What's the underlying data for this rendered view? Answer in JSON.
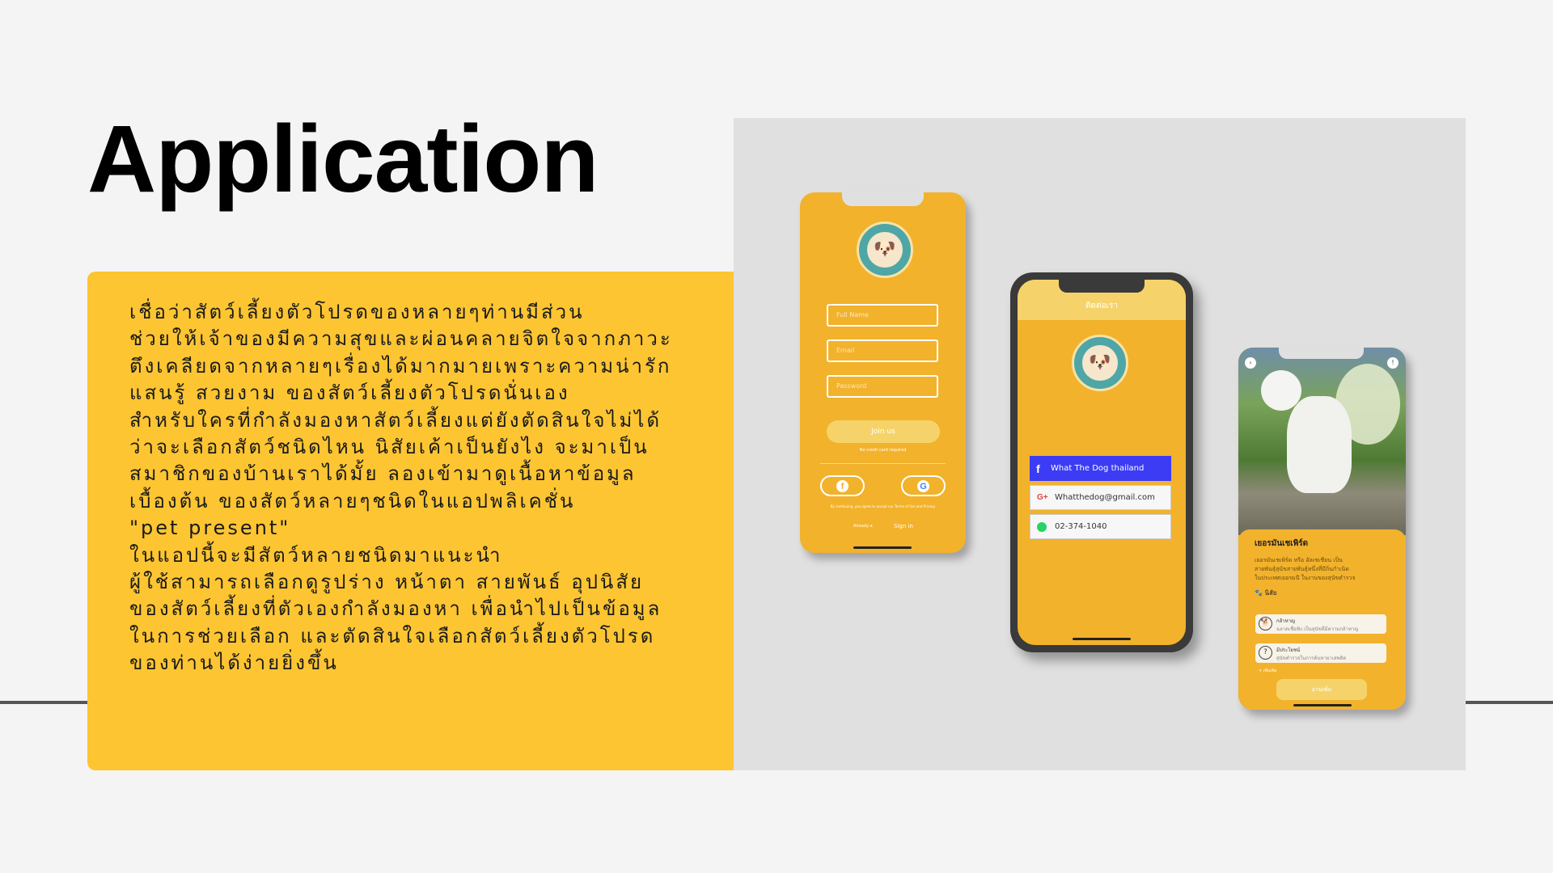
{
  "title": "Application",
  "description_lines": [
    "เชื่อว่าสัตว์เลี้ยงตัวโปรดของหลายๆท่านมีส่วน",
    "ช่วยให้เจ้าของมีความสุขและผ่อนคลายจิตใจจากภาวะ",
    "ตึงเคลียดจากหลายๆเรื่องได้มากมายเพราะความน่ารัก",
    "แสนรู้ สวยงาม ของสัตว์เลี้ยงตัวโปรดนั่นเอง",
    "สำหรับใครที่กำลังมองหาสัตว์เลี้ยงแต่ยังตัดสินใจไม่ได้",
    "ว่าจะเลือกสัตว์ชนิดไหน นิสัยเค้าเป็นยังไง จะมาเป็น",
    "สมาชิกของบ้านเราได้มั้ย ลองเข้ามาดูเนื้อหาข้อมูล",
    "เบื้องต้น ของสัตว์หลายๆชนิดในแอปพลิเคชั่น",
    "\"pet present\"",
    "ในแอปนี้จะมีสัตว์หลายชนิดมาแนะนำ",
    "ผู้ใช้สามารถเลือกดูรูปร่าง หน้าตา สายพันธ์ อุปนิสัย",
    "ของสัตว์เลี้ยงที่ตัวเองกำลังมองหา เพื่อนำไปเป็นข้อมูล",
    "ในการช่วยเลือก และตัดสินใจเลือกสัตว์เลี้ยงตัวโปรด",
    "ของท่านได้ง่ายยิ่งขึ้น"
  ],
  "signup_screen": {
    "fields": [
      "Full Name",
      "Email",
      "Password"
    ],
    "join_label": "Join us",
    "note": "No credit card required",
    "terms": "By continuing, you agree to accept our Terms of Use and Privacy",
    "already_label": "Already a",
    "signin_label": "Sign in"
  },
  "contact_screen": {
    "header": "ติดต่อเรา",
    "facebook": "What The Dog thailand",
    "email": "Whatthedog@gmail.com",
    "phone": "02-374-1040"
  },
  "breed_screen": {
    "breed_name": "เยอรมันเชเพิร์ด",
    "desc_lines": [
      "เยอรมันเชเพิร์ด หรือ อัลเซเชียน เป็น",
      "สายพันธุ์สุนัขสายพันธุ์หนึ่งที่มีถิ่นกำเนิด",
      "ในประเทศเยอรมนี ในงานของสุนัขตำรวจ"
    ],
    "traits_heading": "นิสัย",
    "traits": [
      {
        "title": "กล้าหาญ",
        "desc": "ฉลาดเชื่อฟัง เป็นสุนัขที่มีความกล้าหาญ"
      },
      {
        "title": "มีประโยชน์",
        "desc": "สุนัขตำรวจในการค้นหายาเสพติด"
      }
    ],
    "see_more_small": "+ เพิ่มเติม",
    "more_label": "อ่านเพิ่ม"
  },
  "colors": {
    "accent_yellow": "#fdc532",
    "app_orange": "#f2b22c",
    "facebook_blue": "#3c3cf5"
  }
}
